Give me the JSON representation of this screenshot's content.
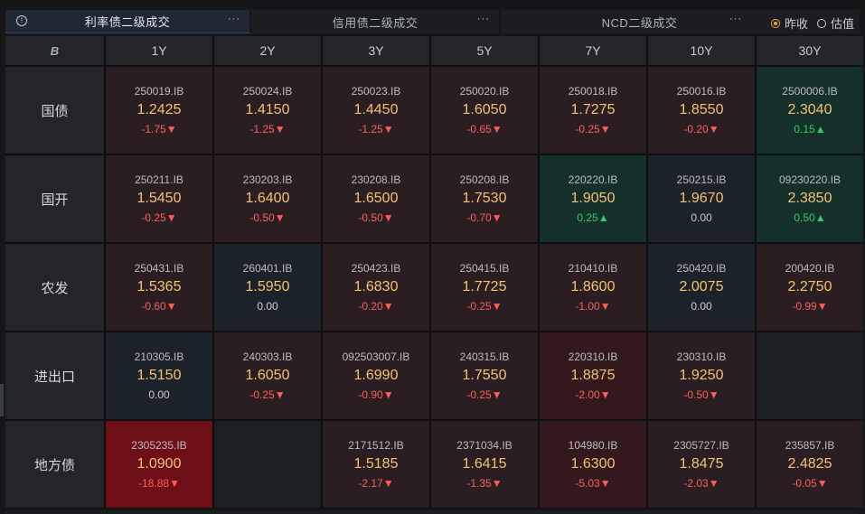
{
  "tabs": [
    {
      "label": "利率债二级成交",
      "active": true,
      "more": "···",
      "info": "!"
    },
    {
      "label": "信用债二级成交",
      "active": false,
      "more": "···"
    },
    {
      "label": "NCD二级成交",
      "active": false,
      "more": "···"
    }
  ],
  "radios": [
    {
      "label": "昨收",
      "checked": true
    },
    {
      "label": "估值",
      "checked": false
    }
  ],
  "corner_icon": "B",
  "columns": [
    "1Y",
    "2Y",
    "3Y",
    "5Y",
    "7Y",
    "10Y",
    "30Y"
  ],
  "rows": [
    {
      "label": "国债",
      "cells": [
        {
          "code": "250019.IB",
          "yield": "1.2425",
          "chg": "-1.75▼",
          "dir": "down",
          "bg": "red1"
        },
        {
          "code": "250024.IB",
          "yield": "1.4150",
          "chg": "-1.25▼",
          "dir": "down",
          "bg": "red1"
        },
        {
          "code": "250023.IB",
          "yield": "1.4450",
          "chg": "-1.25▼",
          "dir": "down",
          "bg": "red1"
        },
        {
          "code": "250020.IB",
          "yield": "1.6050",
          "chg": "-0.65▼",
          "dir": "down",
          "bg": "red1"
        },
        {
          "code": "250018.IB",
          "yield": "1.7275",
          "chg": "-0.25▼",
          "dir": "down",
          "bg": "red1"
        },
        {
          "code": "250016.IB",
          "yield": "1.8550",
          "chg": "-0.20▼",
          "dir": "down",
          "bg": "red1"
        },
        {
          "code": "2500006.IB",
          "yield": "2.3040",
          "chg": "0.15▲",
          "dir": "up",
          "bg": "green"
        }
      ]
    },
    {
      "label": "国开",
      "cells": [
        {
          "code": "250211.IB",
          "yield": "1.5450",
          "chg": "-0.25▼",
          "dir": "down",
          "bg": "red1"
        },
        {
          "code": "230203.IB",
          "yield": "1.6400",
          "chg": "-0.50▼",
          "dir": "down",
          "bg": "red1"
        },
        {
          "code": "230208.IB",
          "yield": "1.6500",
          "chg": "-0.50▼",
          "dir": "down",
          "bg": "red1"
        },
        {
          "code": "250208.IB",
          "yield": "1.7530",
          "chg": "-0.70▼",
          "dir": "down",
          "bg": "red1"
        },
        {
          "code": "220220.IB",
          "yield": "1.9050",
          "chg": "0.25▲",
          "dir": "up",
          "bg": "green"
        },
        {
          "code": "250215.IB",
          "yield": "1.9670",
          "chg": "0.00",
          "dir": "flat",
          "bg": "neutral"
        },
        {
          "code": "09230220.IB",
          "yield": "2.3850",
          "chg": "0.50▲",
          "dir": "up",
          "bg": "green"
        }
      ]
    },
    {
      "label": "农发",
      "cells": [
        {
          "code": "250431.IB",
          "yield": "1.5365",
          "chg": "-0.60▼",
          "dir": "down",
          "bg": "red1"
        },
        {
          "code": "260401.IB",
          "yield": "1.5950",
          "chg": "0.00",
          "dir": "flat",
          "bg": "neutral"
        },
        {
          "code": "250423.IB",
          "yield": "1.6830",
          "chg": "-0.20▼",
          "dir": "down",
          "bg": "red1"
        },
        {
          "code": "250415.IB",
          "yield": "1.7725",
          "chg": "-0.25▼",
          "dir": "down",
          "bg": "red1"
        },
        {
          "code": "210410.IB",
          "yield": "1.8600",
          "chg": "-1.00▼",
          "dir": "down",
          "bg": "red1"
        },
        {
          "code": "250420.IB",
          "yield": "2.0075",
          "chg": "0.00",
          "dir": "flat",
          "bg": "neutral"
        },
        {
          "code": "200420.IB",
          "yield": "2.2750",
          "chg": "-0.99▼",
          "dir": "down",
          "bg": "red1"
        }
      ]
    },
    {
      "label": "进出口",
      "cells": [
        {
          "code": "210305.IB",
          "yield": "1.5150",
          "chg": "0.00",
          "dir": "flat",
          "bg": "neutral"
        },
        {
          "code": "240303.IB",
          "yield": "1.6050",
          "chg": "-0.25▼",
          "dir": "down",
          "bg": "red1"
        },
        {
          "code": "092503007.IB",
          "yield": "1.6990",
          "chg": "-0.90▼",
          "dir": "down",
          "bg": "red1"
        },
        {
          "code": "240315.IB",
          "yield": "1.7550",
          "chg": "-0.25▼",
          "dir": "down",
          "bg": "red1"
        },
        {
          "code": "220310.IB",
          "yield": "1.8875",
          "chg": "-2.00▼",
          "dir": "down",
          "bg": "red2"
        },
        {
          "code": "230310.IB",
          "yield": "1.9250",
          "chg": "-0.50▼",
          "dir": "down",
          "bg": "red1"
        },
        {
          "code": "",
          "yield": "",
          "chg": "",
          "dir": "flat",
          "bg": "empty"
        }
      ]
    },
    {
      "label": "地方债",
      "cells": [
        {
          "code": "2305235.IB",
          "yield": "1.0900",
          "chg": "-18.88▼",
          "dir": "down",
          "bg": "red3"
        },
        {
          "code": "",
          "yield": "",
          "chg": "",
          "dir": "flat",
          "bg": "empty"
        },
        {
          "code": "2171512.IB",
          "yield": "1.5185",
          "chg": "-2.17▼",
          "dir": "down",
          "bg": "red1"
        },
        {
          "code": "2371034.IB",
          "yield": "1.6415",
          "chg": "-1.35▼",
          "dir": "down",
          "bg": "red1"
        },
        {
          "code": "104980.IB",
          "yield": "1.6300",
          "chg": "-5.03▼",
          "dir": "down",
          "bg": "red2"
        },
        {
          "code": "2305727.IB",
          "yield": "1.8475",
          "chg": "-2.03▼",
          "dir": "down",
          "bg": "red1"
        },
        {
          "code": "235857.IB",
          "yield": "2.4825",
          "chg": "-0.05▼",
          "dir": "down",
          "bg": "red1"
        }
      ]
    }
  ]
}
